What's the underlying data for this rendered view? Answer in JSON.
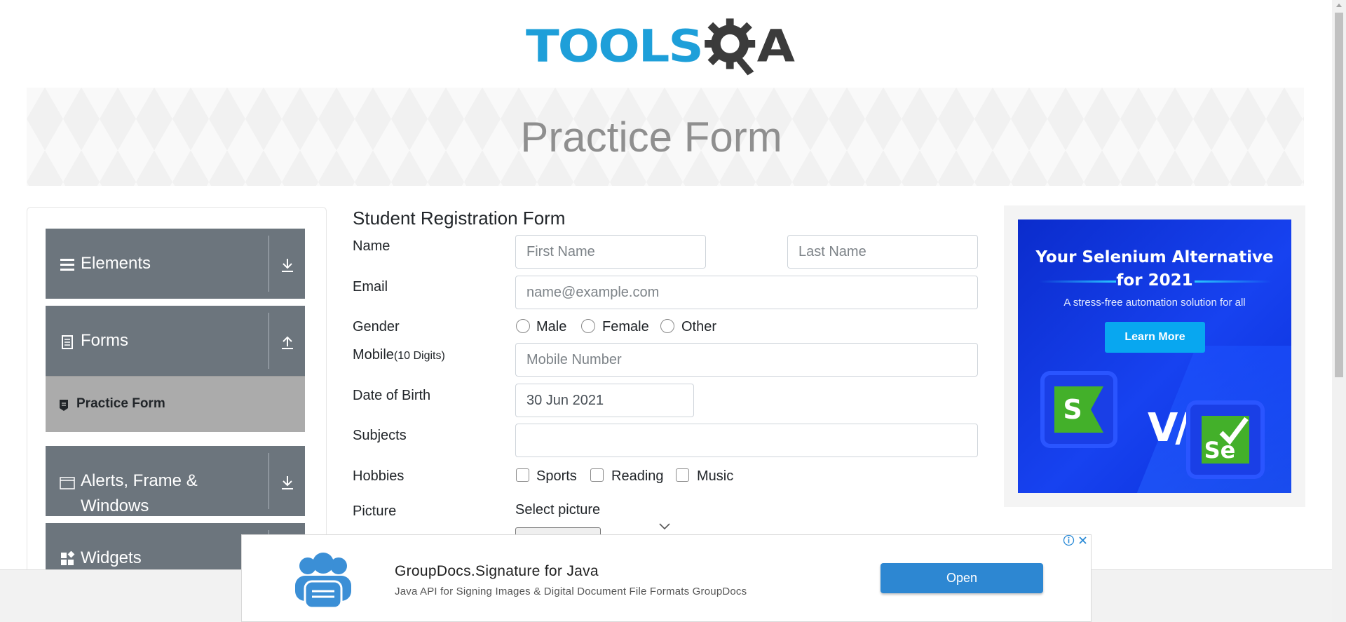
{
  "brand": {
    "logo_text": "TOOLSQA"
  },
  "page_title": "Practice Form",
  "sidebar": {
    "groups": [
      {
        "label": "Elements",
        "icon": "hamburger-icon",
        "arrow": "download-arrow-icon"
      },
      {
        "label": "Forms",
        "icon": "document-icon",
        "arrow": "upload-arrow-icon"
      },
      {
        "label": "Alerts, Frame &",
        "label2": "Windows",
        "icon": "window-icon",
        "arrow": "download-arrow-icon"
      },
      {
        "label": "Widgets",
        "icon": "widgets-icon"
      }
    ],
    "active_item": {
      "label": "Practice Form",
      "icon": "list-icon"
    }
  },
  "form": {
    "title": "Student Registration Form",
    "name_label": "Name",
    "first_name_placeholder": "First Name",
    "last_name_placeholder": "Last Name",
    "email_label": "Email",
    "email_placeholder": "name@example.com",
    "gender_label": "Gender",
    "gender_options": [
      "Male",
      "Female",
      "Other"
    ],
    "mobile_label": "Mobile",
    "mobile_hint": "(10 Digits)",
    "mobile_placeholder": "Mobile Number",
    "dob_label": "Date of Birth",
    "dob_value": "30 Jun 2021",
    "subjects_label": "Subjects",
    "subjects_value": "",
    "hobbies_label": "Hobbies",
    "hobbies_options": [
      "Sports",
      "Reading",
      "Music"
    ],
    "picture_label": "Picture",
    "picture_select_label": "Select picture"
  },
  "side_ad": {
    "title_line1": "Your Selenium Alternative",
    "title_line2": "for 2021",
    "subtitle": "A stress-free automation solution for all",
    "button": "Learn More",
    "vs_text": "V/s",
    "logo_left": "S",
    "logo_right": "Se",
    "colors": {
      "background": "#1235e6",
      "button": "#08a7f0",
      "logo_green": "#43b02a"
    }
  },
  "bottom_ad": {
    "title": "GroupDocs.Signature for Java",
    "description": "Java API for Signing Images & Digital Document File Formats GroupDocs",
    "button": "Open",
    "colors": {
      "button": "#2d87d2",
      "logo": "#3b8fd6"
    }
  },
  "colors": {
    "sidebar_group": "#6c757d",
    "sidebar_active": "#ababab",
    "logo_blue": "#1e9fd9",
    "logo_dark": "#3b3b3b"
  }
}
